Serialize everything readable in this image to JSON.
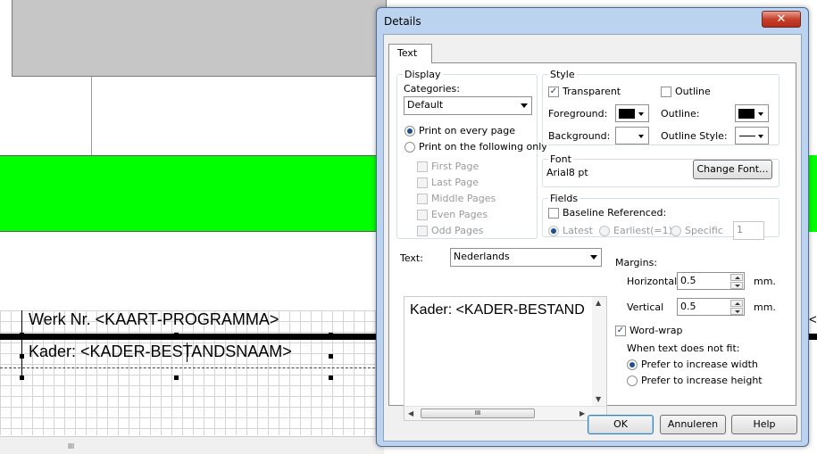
{
  "designer": {
    "band_text_1": "Werk Nr. <KAART-PROGRAMMA>",
    "band_text_2": "Kader: <KADER-BESTANDSNAAM>",
    "right_caret": "<",
    "scroll_grip": "III"
  },
  "dialog": {
    "title": "Details",
    "close_glyph": "✕",
    "tab_text": "Text",
    "display": {
      "legend": "Display",
      "categories_label": "Categories:",
      "categories_value": "Default",
      "print_every_page": "Print on every page",
      "print_following": "Print on the following only",
      "pages": [
        "First Page",
        "Last Page",
        "Middle Pages",
        "Even Pages",
        "Odd Pages"
      ]
    },
    "style": {
      "legend": "Style",
      "transparent_label": "Transparent",
      "transparent_checked": true,
      "outline_label": "Outline",
      "outline_checked": false,
      "foreground_label": "Foreground:",
      "foreground_color": "#000000",
      "outline_color_label": "Outline:",
      "outline_color": "#000000",
      "background_label": "Background:",
      "outline_style_label": "Outline Style:"
    },
    "font": {
      "legend": "Font",
      "value": "Arial8 pt",
      "change_button": "Change Font..."
    },
    "fields": {
      "legend": "Fields",
      "baseline_label": "Baseline Referenced:",
      "latest": "Latest",
      "earliest": "Earliest(=1)",
      "specific": "Specific",
      "specific_value": "1"
    },
    "text_section": {
      "label": "Text:",
      "language": "Nederlands",
      "content": "Kader: <KADER-BESTAND",
      "hscroll_grip": "III"
    },
    "margins": {
      "label": "Margins:",
      "horizontal_label": "Horizontal",
      "horizontal_value": "0.5",
      "vertical_label": "Vertical",
      "vertical_value": "0.5",
      "unit": "mm."
    },
    "wrap": {
      "wordwrap_label": "Word-wrap",
      "wordwrap_checked": true,
      "not_fit_label": "When text does not fit:",
      "prefer_width": "Prefer to increase width",
      "prefer_height": "Prefer to increase height"
    },
    "buttons": {
      "ok": "OK",
      "cancel": "Annuleren",
      "help": "Help"
    }
  }
}
